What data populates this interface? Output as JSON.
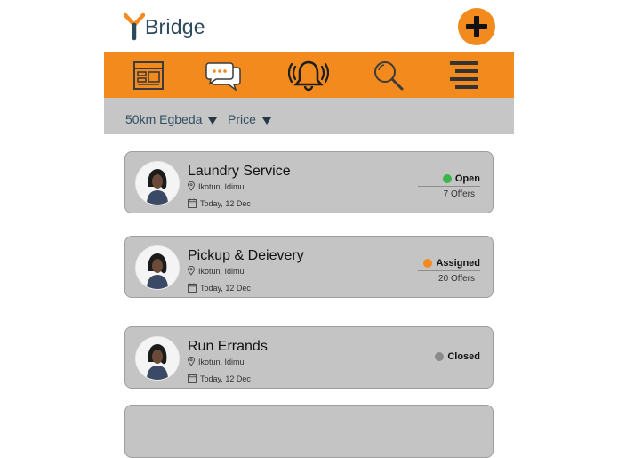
{
  "header": {
    "brand": "Bridge",
    "logo_icon": "y-logo-icon",
    "add_icon": "plus-icon"
  },
  "nav": {
    "items": [
      {
        "name": "feed",
        "icon": "layout-icon"
      },
      {
        "name": "messages",
        "icon": "chat-icon"
      },
      {
        "name": "notifications",
        "icon": "bell-icon"
      },
      {
        "name": "search",
        "icon": "search-icon"
      },
      {
        "name": "menu",
        "icon": "menu-icon"
      }
    ]
  },
  "filters": {
    "location": "50km Egbeda",
    "price": "Price"
  },
  "tasks": [
    {
      "title": "Laundry Service",
      "location": "Ikotun, Idimu",
      "date": "Today, 12 Dec",
      "status": "Open",
      "status_color": "#3cb54a",
      "offers": "7 Offers"
    },
    {
      "title": "Pickup & Deievery",
      "location": "Ikotun, Idimu",
      "date": "Today, 12 Dec",
      "status": "Assigned",
      "status_color": "#f28a1d",
      "offers": "20 Offers"
    },
    {
      "title": "Run Errands",
      "location": "Ikotun, Idimu",
      "date": "Today, 12 Dec",
      "status": "Closed",
      "status_color": "#8a8a8a",
      "offers": ""
    }
  ],
  "colors": {
    "accent": "#f28a1d",
    "filter_bg": "#c6c6c6",
    "card_bg": "#c4c4c4",
    "brand_text": "#2d4a5c"
  }
}
